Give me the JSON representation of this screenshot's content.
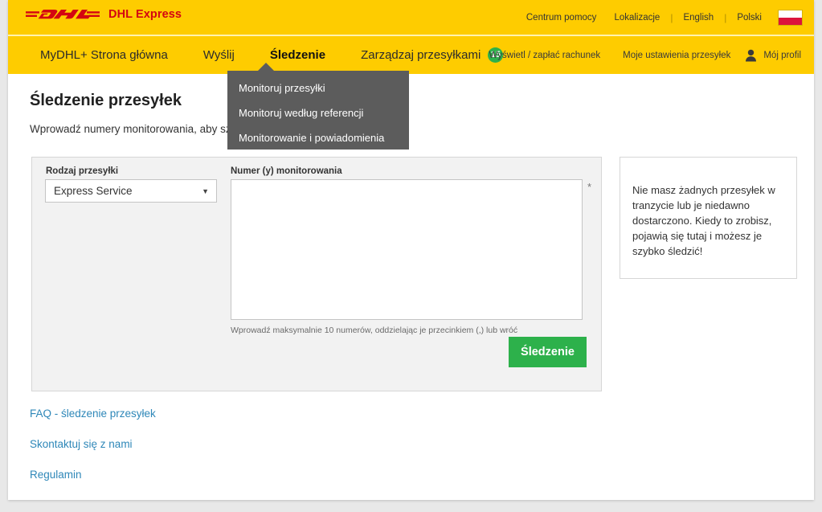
{
  "header": {
    "logo_alt": "DHL",
    "logo_text": "DHL Express",
    "utility_links": [
      {
        "label": "Centrum pomocy"
      },
      {
        "label": "Lokalizacje"
      },
      {
        "label": "English"
      },
      {
        "label": "Polski"
      }
    ],
    "separator": "|",
    "flag_alt": "Polska"
  },
  "nav": {
    "items": [
      {
        "label": "MyDHL+ Strona główna",
        "active": false
      },
      {
        "label": "Wyślij",
        "active": false
      },
      {
        "label": "Śledzenie",
        "active": true
      },
      {
        "label": "Zarządzaj przesyłkami",
        "active": false,
        "badge": "15"
      }
    ],
    "right_links": [
      {
        "label": "Wyświetl / zapłać rachunek"
      },
      {
        "label": "Moje ustawienia przesyłek"
      }
    ],
    "profile_label": "Mój profil"
  },
  "dropdown": {
    "items": [
      {
        "label": "Monitoruj przesyłki"
      },
      {
        "label": "Monitoruj według referencji"
      },
      {
        "label": "Monitorowanie i powiadomienia"
      }
    ]
  },
  "main": {
    "title": "Śledzenie przesyłek",
    "intro": "Wprowadź numery monitorowania, aby szybko sprawdzić status przesyłki"
  },
  "form": {
    "shipment_type_label": "Rodzaj przesyłki",
    "shipment_type_value": "Express Service",
    "shipment_type_caret": "▼",
    "tracking_label": "Numer (y) monitorowania",
    "tracking_value": "",
    "tracking_placeholder": "",
    "required_marker": "*",
    "hint": "Wprowadź maksymalnie 10 numerów, oddzielając je przecinkiem (,) lub wróć",
    "submit_label": "Śledzenie"
  },
  "info_panel": {
    "text": "Nie masz żadnych przesyłek w tranzycie lub je niedawno dostarczono. Kiedy to zrobisz, pojawią się tutaj i możesz je szybko śledzić!"
  },
  "footer_links": [
    {
      "label": "FAQ - śledzenie przesyłek"
    },
    {
      "label": "Skontaktuj się z nami"
    },
    {
      "label": "Regulamin"
    }
  ],
  "colors": {
    "dhl_yellow": "#fecc00",
    "dhl_red": "#d40511",
    "green_accent": "#2db14b",
    "link_blue": "#2e87b8",
    "dropdown_gray": "#5c5c5c"
  }
}
